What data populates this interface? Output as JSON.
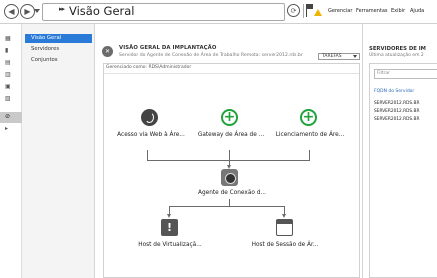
{
  "header": {
    "title_arrows": "▸▸",
    "title": "Visão Geral",
    "menu": [
      "Gerenciar",
      "Ferramentas",
      "Exibir",
      "Ajuda"
    ]
  },
  "nav": {
    "items": [
      "Visão Geral",
      "Servidores",
      "Conjuntos"
    ]
  },
  "overview": {
    "title": "VISÃO GERAL DA IMPLANTAÇÃO",
    "subtitle": "Servidor do Agente de Conexão de Área de Trabalho Remota: server2012.rds.br",
    "tasks_label": "TAREFAS",
    "managed_as": "Gerenciado como: RDS\\Administrador",
    "nodes": {
      "web": "Acesso via Web à Áre...",
      "gateway": "Gateway de Área de ...",
      "licensing": "Licenciamento de Áre...",
      "broker": "Agente de Conexão d...",
      "virt": "Host de Virtualizaçã...",
      "session": "Host de Sessão de Ár..."
    }
  },
  "servers_panel": {
    "title": "SERVIDORES DE IM",
    "subtitle": "Última atualização em 2",
    "filter_placeholder": "Filtrar",
    "column": "FQDN do Servidor",
    "rows": [
      "SERVER2012.RDS.BR",
      "SERVER2012.RDS.BR",
      "SERVER2012.RDS.BR"
    ]
  },
  "colors": {
    "accent": "#2a7ad8",
    "plus_green": "#20a33b",
    "warning": "#f0b400"
  }
}
